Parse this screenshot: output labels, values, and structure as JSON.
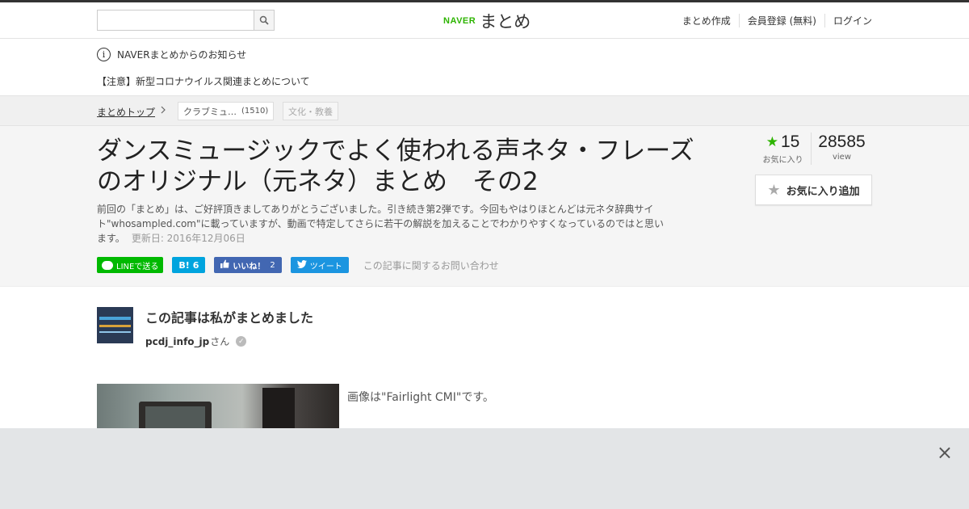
{
  "topbar": {
    "search_placeholder": "",
    "search_icon": "search-icon",
    "logo_naver": "NAVER",
    "logo_matome": "まとめ",
    "links": [
      "まとめ作成",
      "会員登録 (無料)",
      "ログイン"
    ]
  },
  "notice": {
    "icon": "info-icon",
    "info_glyph": "i",
    "title": "NAVERまとめからのお知らせ",
    "item": "【注意】新型コロナウイルス関連まとめについて"
  },
  "breadcrumb": {
    "top": "まとめトップ",
    "category": "クラブミュ…",
    "category_count": "(1510)",
    "tag": "文化・教養"
  },
  "article": {
    "title": "ダンスミュージックでよく使われる声ネタ・フレーズのオリジナル（元ネタ）まとめ　その2",
    "description": "前回の「まとめ」は、ご好評頂きましてありがとうございました。引き続き第2弾です。今回もやはりほとんどは元ネタ辞典サイト\"whosampled.com\"に載っていますが、動画で特定してさらに若干の解説を加えることでわかりやすくなっているのではと思います。",
    "updated": "更新日: 2016年12月06日",
    "favorites": "15",
    "favorites_label": "お気に入り",
    "views": "28585",
    "views_label": "view",
    "fav_button": "お気に入り追加"
  },
  "share": {
    "line": "LINEで送る",
    "hatena_icon": "B!",
    "hatena_count": "6",
    "facebook": "いいね！",
    "facebook_count": "2",
    "twitter": "ツイート",
    "contact": "この記事に関するお問い合わせ"
  },
  "author": {
    "heading": "この記事は私がまとめました",
    "username": "pcdj_info_jp",
    "suffix": "さん"
  },
  "content": {
    "caption": "画像は\"Fairlight CMI\"です。"
  },
  "overlay": {
    "close": "×"
  },
  "colors": {
    "naver_green": "#2db400",
    "line_green": "#00b900",
    "hatena_blue": "#00a4de",
    "facebook_blue": "#4267b2",
    "twitter_blue": "#1b95e0"
  }
}
